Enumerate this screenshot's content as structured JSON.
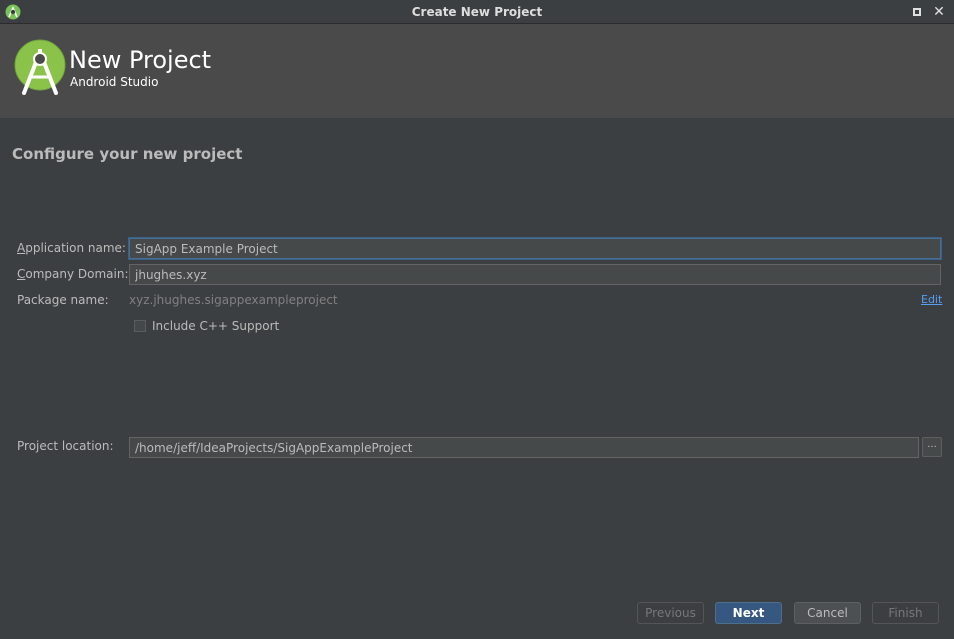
{
  "window": {
    "title": "Create New Project",
    "icons": {
      "app": "android-studio-icon",
      "maximize": "maximize-icon",
      "close": "close-icon"
    },
    "close_glyph": "✕"
  },
  "banner": {
    "title": "New Project",
    "subtitle": "Android Studio"
  },
  "section": {
    "title": "Configure your new project"
  },
  "form": {
    "app_name": {
      "label_mnemonic": "A",
      "label_rest": "pplication name:",
      "value": "SigApp Example Project"
    },
    "company_domain": {
      "label_mnemonic": "C",
      "label_rest": "ompany Domain:",
      "value": "jhughes.xyz"
    },
    "package_name": {
      "label": "Package name:",
      "value": "xyz.jhughes.sigappexampleproject",
      "edit_label": "Edit"
    },
    "cpp_support": {
      "label": "Include C++ Support",
      "checked": false
    },
    "project_location": {
      "label": "Project location:",
      "value": "/home/jeff/IdeaProjects/SigAppExampleProject",
      "browse_label": "..."
    }
  },
  "buttons": {
    "previous": "Previous",
    "next": "Next",
    "cancel": "Cancel",
    "finish": "Finish"
  },
  "colors": {
    "background": "#3c3f41",
    "banner": "#4a4a4a",
    "accent": "#365880",
    "android_green": "#8bc34a",
    "link": "#589df6"
  }
}
